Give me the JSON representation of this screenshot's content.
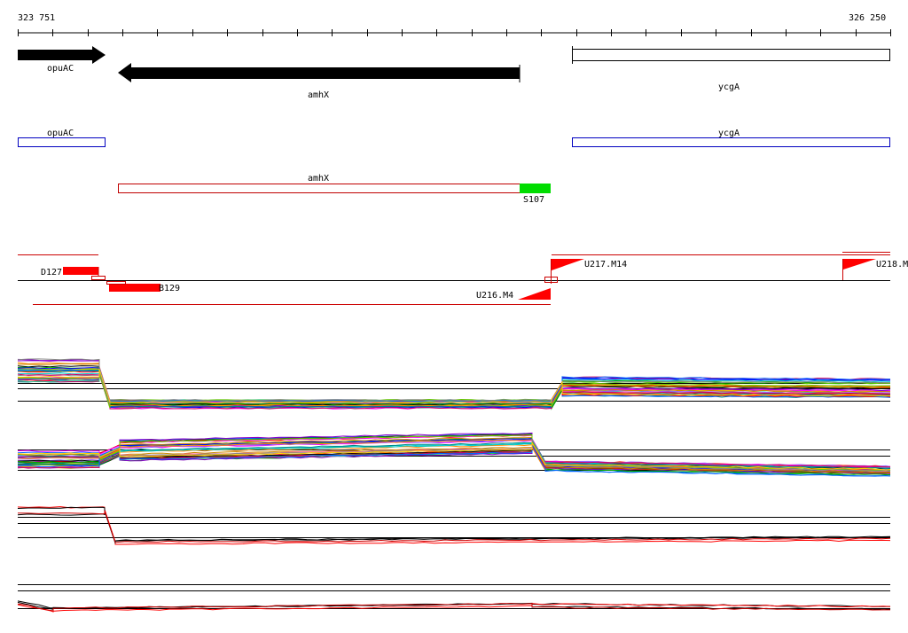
{
  "ruler": {
    "start_label": "323 751",
    "end_label": "326 250",
    "start": 323751,
    "end": 326250
  },
  "genes": [
    {
      "name": "opuAC",
      "strand": "+",
      "start": 323751,
      "end": 323997
    },
    {
      "name": "amhX",
      "strand": "-",
      "start": 324035,
      "end": 325170
    },
    {
      "name": "ycgA",
      "strand": "+",
      "start": 325367,
      "end": 326250
    }
  ],
  "annotations": {
    "opuAC": "opuAC",
    "ycgA": "ycgA",
    "amhX": "amhX",
    "segment": "S107"
  },
  "features": {
    "d127": "D127",
    "b129": "B129",
    "u217": "U217.M14",
    "u216": "U216.M4",
    "u218": "U218.M"
  },
  "colors": {
    "gene_arrow": "#000000",
    "blue_box": "#0000c0",
    "red_box": "#c00000",
    "segment": "#00dd00",
    "feature": "#ff0000",
    "line_black": "#000000"
  }
}
